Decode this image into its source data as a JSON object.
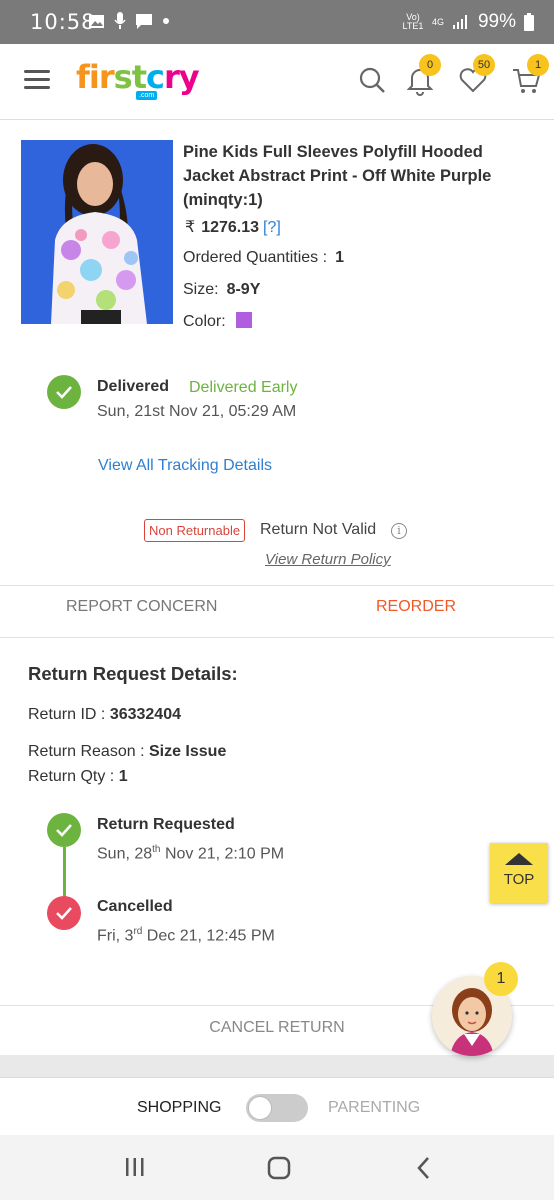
{
  "status_bar": {
    "time": "10:58",
    "network": "Vo) LTE1",
    "network_type": "4G",
    "battery": "99%"
  },
  "header": {
    "logo_text": "firstcry",
    "logo_suffix": ".com",
    "notification_count": "0",
    "wishlist_count": "50",
    "cart_count": "1"
  },
  "product": {
    "title": "Pine Kids Full Sleeves Polyfill Hooded Jacket Abstract Print - Off White Purple (minqty:1)",
    "currency": "₹",
    "price": "1276.13",
    "price_help": "[?]",
    "qty_label": "Ordered Quantities :",
    "qty_value": "1",
    "size_label": "Size:",
    "size_value": "8-9Y",
    "color_label": "Color:",
    "color_swatch": "#b05ee0"
  },
  "delivery": {
    "status": "Delivered",
    "tag": "Delivered Early",
    "date": "Sun, 21st Nov 21, 05:29 AM",
    "tracking_link": "View All Tracking Details"
  },
  "returns": {
    "badge": "Non Returnable",
    "status_text": "Return Not Valid",
    "policy_link": "View Return Policy"
  },
  "actions": {
    "report": "REPORT CONCERN",
    "reorder": "REORDER"
  },
  "return_request": {
    "title": "Return Request Details:",
    "id_label": "Return ID :",
    "id_value": "36332404",
    "reason_label": "Return Reason :",
    "reason_value": "Size Issue",
    "qty_label": "Return Qty :",
    "qty_value": "1",
    "timeline": [
      {
        "status": "Return Requested",
        "date_pre": "Sun, 28",
        "date_sup": "th",
        "date_post": " Nov 21, 2:10 PM"
      },
      {
        "status": "Cancelled",
        "date_pre": "Fri, 3",
        "date_sup": "rd",
        "date_post": " Dec 21, 12:45 PM"
      }
    ],
    "cancel_return": "CANCEL RETURN"
  },
  "top_button": "TOP",
  "assistant_badge": "1",
  "mode_toggle": {
    "left": "SHOPPING",
    "right": "PARENTING"
  },
  "colors": {
    "accent_orange": "#f05a28",
    "success_green": "#6cb33f",
    "error_red": "#e84a5f",
    "link_blue": "#2d7fd3"
  }
}
